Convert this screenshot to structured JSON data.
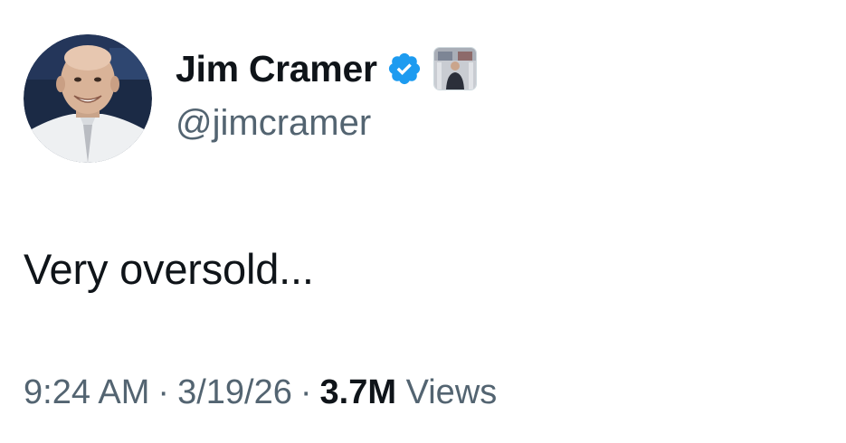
{
  "author": {
    "display_name": "Jim Cramer",
    "handle": "@jimcramer",
    "verified_icon": "verified-badge-icon",
    "affiliate_icon": "affiliate-badge-icon",
    "badge_color": "#1d9bf0"
  },
  "tweet": {
    "text": "Very oversold..."
  },
  "meta": {
    "time": "9:24 AM",
    "separator": "·",
    "date": "3/19/26",
    "views_count": "3.7M",
    "views_label": "Views"
  },
  "colors": {
    "primary_text": "#0f1419",
    "secondary_text": "#536471",
    "background": "#ffffff"
  }
}
